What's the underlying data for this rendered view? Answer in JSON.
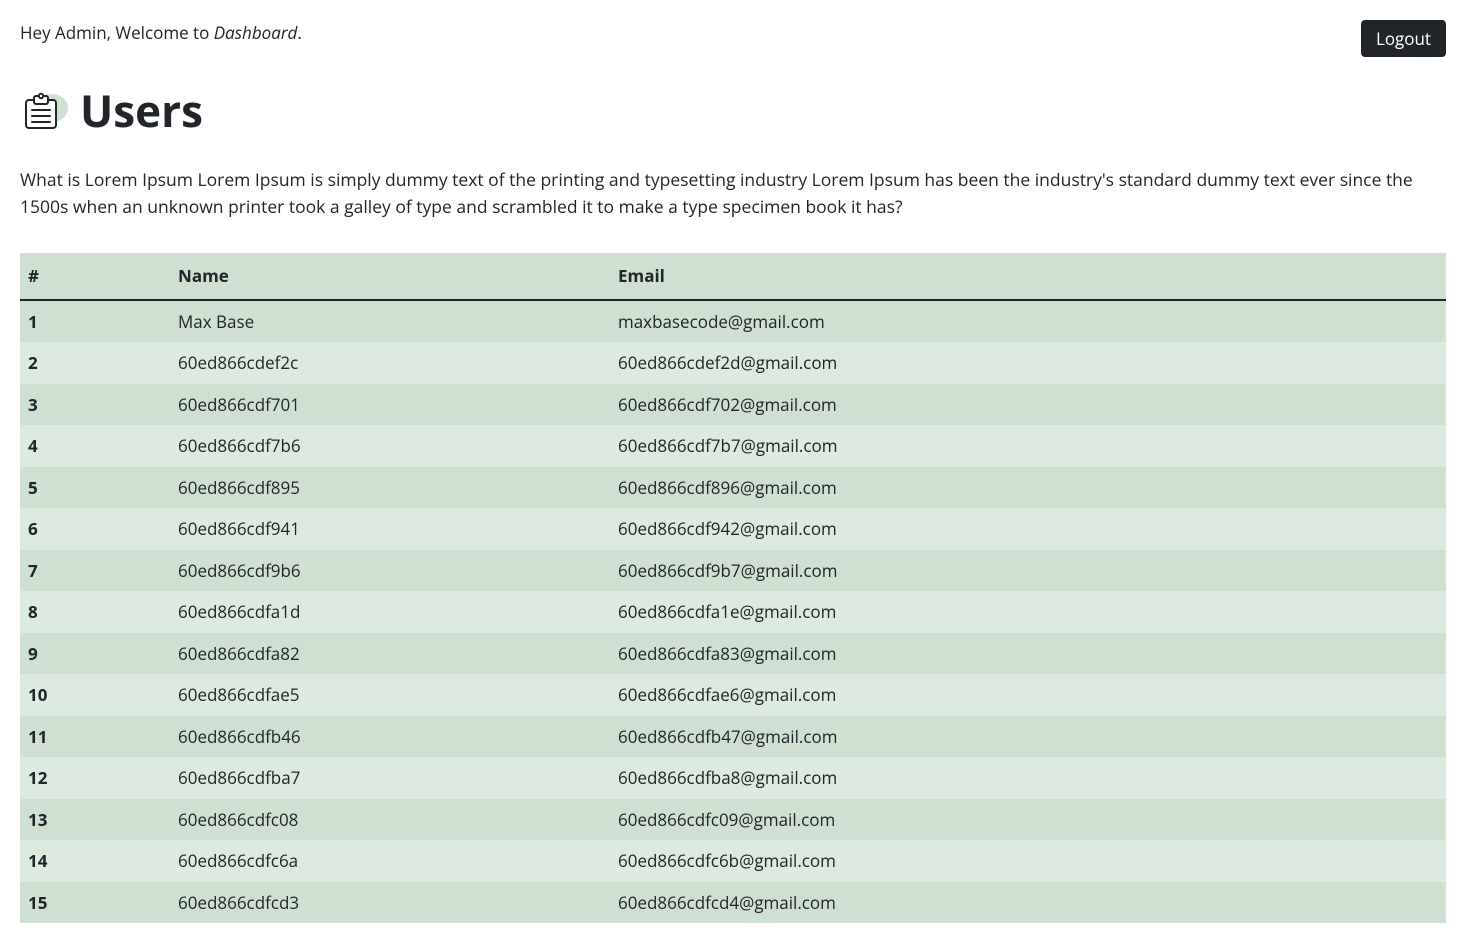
{
  "header": {
    "greeting_prefix": "Hey Admin, Welcome to ",
    "greeting_em": "Dashboard",
    "greeting_suffix": ".",
    "logout_label": "Logout"
  },
  "page": {
    "title": "Users",
    "description": "What is Lorem Ipsum Lorem Ipsum is simply dummy text of the printing and typesetting industry Lorem Ipsum has been the industry's standard dummy text ever since the 1500s when an unknown printer took a galley of type and scrambled it to make a type specimen book it has?"
  },
  "table": {
    "headers": {
      "index": "#",
      "name": "Name",
      "email": "Email"
    },
    "rows": [
      {
        "index": "1",
        "name": "Max Base",
        "email": "maxbasecode@gmail.com"
      },
      {
        "index": "2",
        "name": "60ed866cdef2c",
        "email": "60ed866cdef2d@gmail.com"
      },
      {
        "index": "3",
        "name": "60ed866cdf701",
        "email": "60ed866cdf702@gmail.com"
      },
      {
        "index": "4",
        "name": "60ed866cdf7b6",
        "email": "60ed866cdf7b7@gmail.com"
      },
      {
        "index": "5",
        "name": "60ed866cdf895",
        "email": "60ed866cdf896@gmail.com"
      },
      {
        "index": "6",
        "name": "60ed866cdf941",
        "email": "60ed866cdf942@gmail.com"
      },
      {
        "index": "7",
        "name": "60ed866cdf9b6",
        "email": "60ed866cdf9b7@gmail.com"
      },
      {
        "index": "8",
        "name": "60ed866cdfa1d",
        "email": "60ed866cdfa1e@gmail.com"
      },
      {
        "index": "9",
        "name": "60ed866cdfa82",
        "email": "60ed866cdfa83@gmail.com"
      },
      {
        "index": "10",
        "name": "60ed866cdfae5",
        "email": "60ed866cdfae6@gmail.com"
      },
      {
        "index": "11",
        "name": "60ed866cdfb46",
        "email": "60ed866cdfb47@gmail.com"
      },
      {
        "index": "12",
        "name": "60ed866cdfba7",
        "email": "60ed866cdfba8@gmail.com"
      },
      {
        "index": "13",
        "name": "60ed866cdfc08",
        "email": "60ed866cdfc09@gmail.com"
      },
      {
        "index": "14",
        "name": "60ed866cdfc6a",
        "email": "60ed866cdfc6b@gmail.com"
      },
      {
        "index": "15",
        "name": "60ed866cdfcd3",
        "email": "60ed866cdfcd4@gmail.com"
      }
    ]
  }
}
